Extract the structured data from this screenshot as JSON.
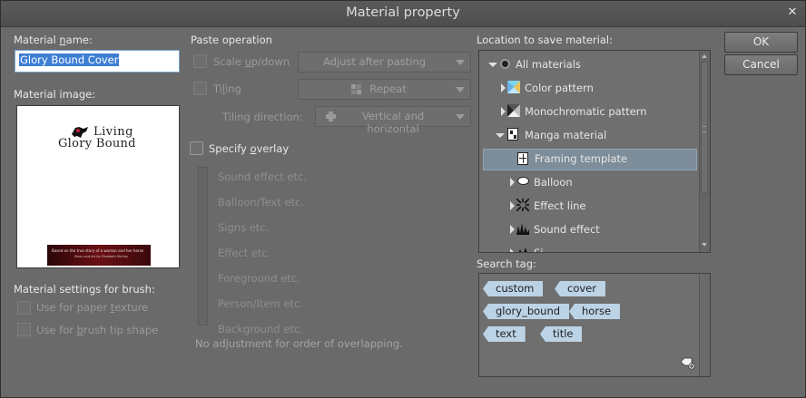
{
  "title": "Material property",
  "material_name": {
    "label_pre": "Material ",
    "label_ul": "n",
    "label_post": "ame:",
    "value": "Glory Bound Cover"
  },
  "material_image": {
    "label": "Material image:",
    "logo_line1": "Living",
    "logo_line2": "Glory Bound",
    "banner_text1": "Based on the true story of a woman and her horse",
    "banner_text2": "Story and Art by Elizabeth Shirley"
  },
  "brush_settings": {
    "label": "Material settings for brush:",
    "paper_texture_pre": "Use for paper ",
    "paper_texture_ul": "t",
    "paper_texture_post": "exture",
    "brush_tip_pre": "Use for ",
    "brush_tip_ul": "b",
    "brush_tip_post": "rush tip shape"
  },
  "paste": {
    "label": "Paste operation",
    "scale_pre": "Scale ",
    "scale_ul": "u",
    "scale_post": "p/down",
    "scale_combo": "Adjust after pasting",
    "tiling_pre": "Ti",
    "tiling_ul": "l",
    "tiling_post": "ing",
    "tiling_combo": "Repeat",
    "tiling_dir_label": "Tiling direction:",
    "tiling_dir_combo": "Vertical and horizontal"
  },
  "overlay": {
    "label_pre": "Specify ",
    "label_ul": "o",
    "label_post": "verlay",
    "items": [
      "Sound effect etc.",
      "Balloon/Text etc.",
      "Signs etc.",
      "Effect etc.",
      "Foreground etc.",
      "Person/Item etc.",
      "Background etc."
    ],
    "note": "No adjustment for order of overlapping."
  },
  "location": {
    "label": "Location to save material:",
    "tree": [
      {
        "label": "All materials",
        "icon": "gear-circle-icon"
      },
      {
        "label": "Color pattern",
        "icon": "color-pattern-icon"
      },
      {
        "label": "Monochromatic pattern",
        "icon": "mono-pattern-icon"
      },
      {
        "label": "Manga material",
        "icon": "manga-material-icon"
      },
      {
        "label": "Framing template",
        "icon": "framing-template-icon"
      },
      {
        "label": "Balloon",
        "icon": "balloon-icon"
      },
      {
        "label": "Effect line",
        "icon": "effect-line-icon"
      },
      {
        "label": "Sound effect",
        "icon": "sound-effect-icon"
      },
      {
        "label": "Si",
        "icon": "sign-icon"
      }
    ]
  },
  "search_tag": {
    "label": "Search tag:",
    "tags": [
      "custom",
      "cover",
      "glory_bound",
      "horse",
      "text",
      "title"
    ]
  },
  "buttons": {
    "ok": "OK",
    "cancel": "Cancel"
  },
  "colors": {
    "accent": "#3e7fd4",
    "tag": "#bcd3e6",
    "selected_row": "#7d8d99"
  }
}
